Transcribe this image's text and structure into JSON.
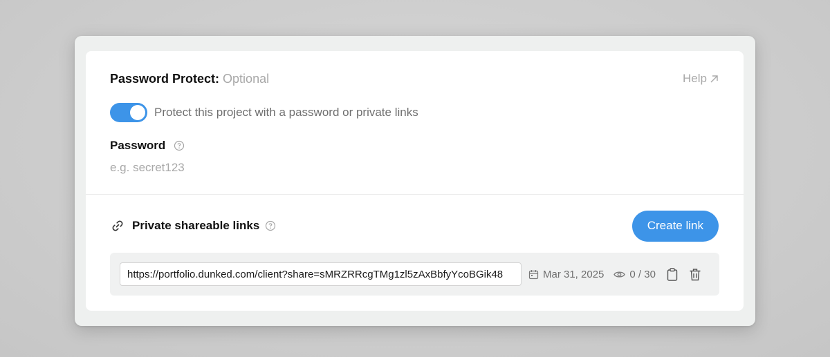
{
  "password_protect": {
    "title": "Password Protect:",
    "optional_label": "Optional",
    "help_label": "Help",
    "toggle_label": "Protect this project with a password or private links",
    "toggle_on": true,
    "password_label": "Password",
    "password_placeholder": "e.g. secret123",
    "password_value": ""
  },
  "shareable_links": {
    "title": "Private shareable links",
    "create_button_label": "Create link",
    "links": [
      {
        "url": "https://portfolio.dunked.com/client?share=sMRZRRcgTMg1zl5zAxBbfyYcoBGik48",
        "date": "Mar 31, 2025",
        "views": "0 / 30"
      }
    ]
  },
  "colors": {
    "accent": "#3d94e8",
    "muted_text": "#a8a8a8",
    "link_bar_bg": "#f0f1f1"
  },
  "icons": {
    "help": "arrow-up-right-icon",
    "question": "question-circle-icon",
    "link": "link-icon",
    "calendar": "calendar-icon",
    "eye": "eye-icon",
    "copy": "clipboard-icon",
    "delete": "trash-icon"
  }
}
